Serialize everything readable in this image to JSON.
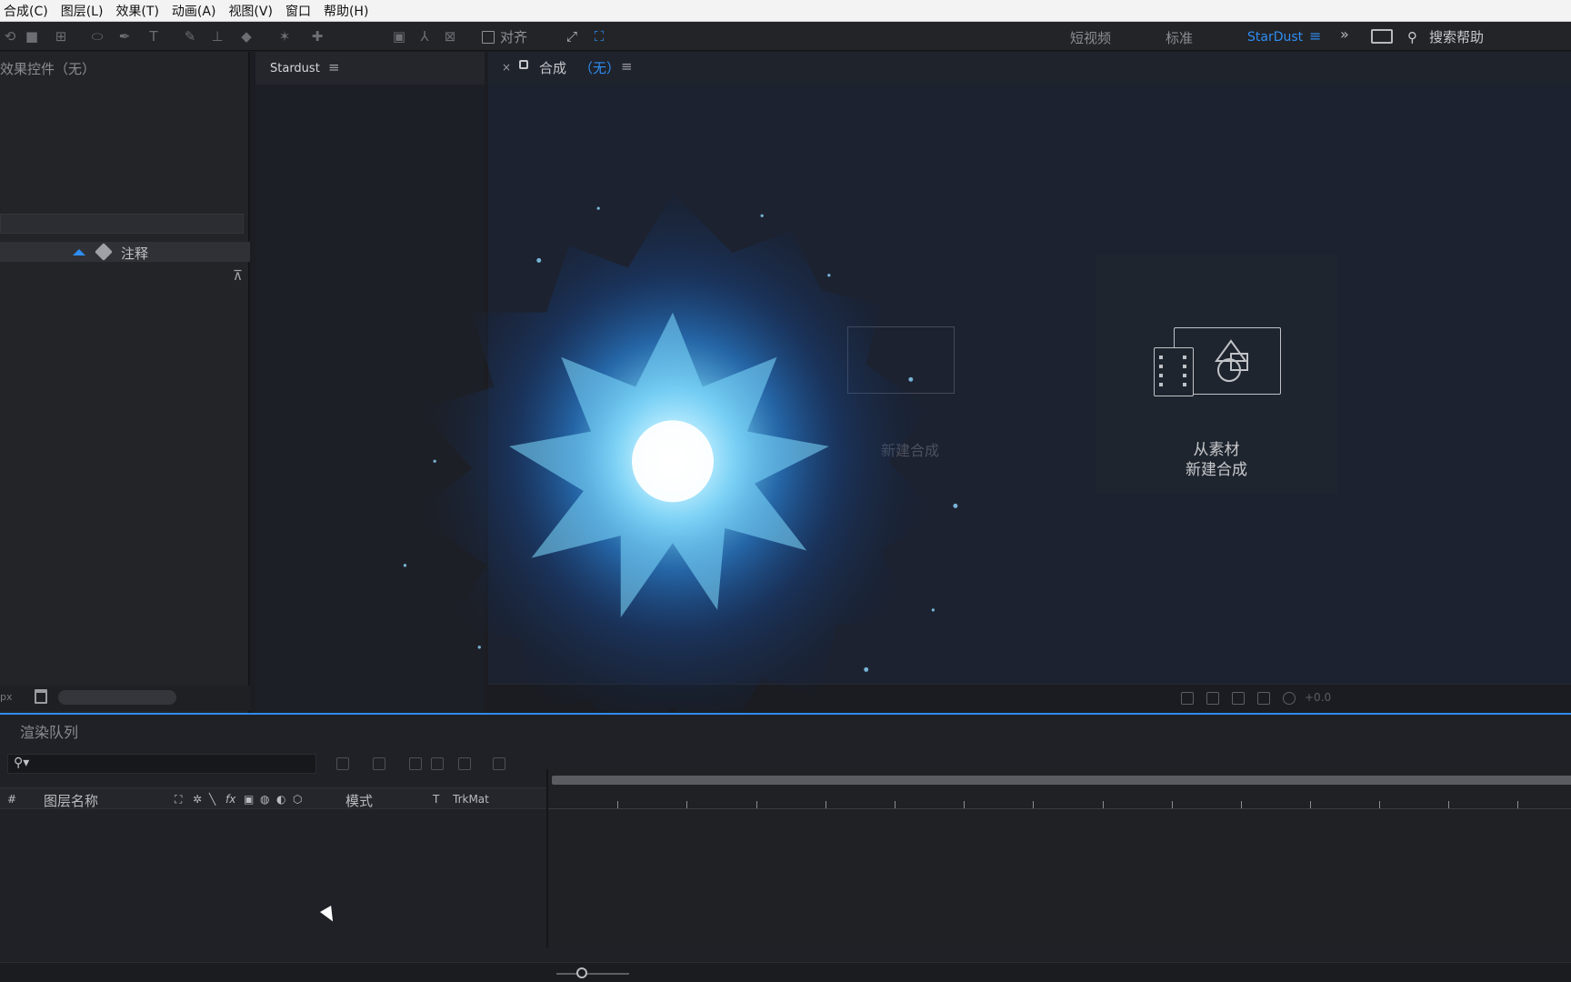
{
  "menu": {
    "items": [
      "合成(C)",
      "图层(L)",
      "效果(T)",
      "动画(A)",
      "视图(V)",
      "窗口",
      "帮助(H)"
    ]
  },
  "toolbar": {
    "snap_label": "对齐",
    "workspaces": [
      "短视频",
      "标准",
      "StarDust"
    ],
    "active_workspace": "StarDust",
    "search_help_label": "搜索帮助"
  },
  "left_panel": {
    "title": "效果控件（无）",
    "comment_header": "注释",
    "footer_unit": "px"
  },
  "stardust_panel": {
    "tab_label": "Stardust"
  },
  "comp_panel": {
    "tab_prefix": "合成",
    "tab_suffix": "（无）",
    "new_comp_line1": "从素材",
    "new_comp_line2": "新建合成",
    "ghost_label": "新建合成",
    "zoom_readout": "+0.0"
  },
  "timeline": {
    "tab_label": "渲染队列",
    "columns": {
      "number": "#",
      "layer_name": "图层名称",
      "mode": "模式",
      "t": "T",
      "trkmat": "TrkMat"
    }
  },
  "colors": {
    "accent": "#2f8df2",
    "panel_bg": "#232428",
    "comp_bg": "#1c2230"
  }
}
